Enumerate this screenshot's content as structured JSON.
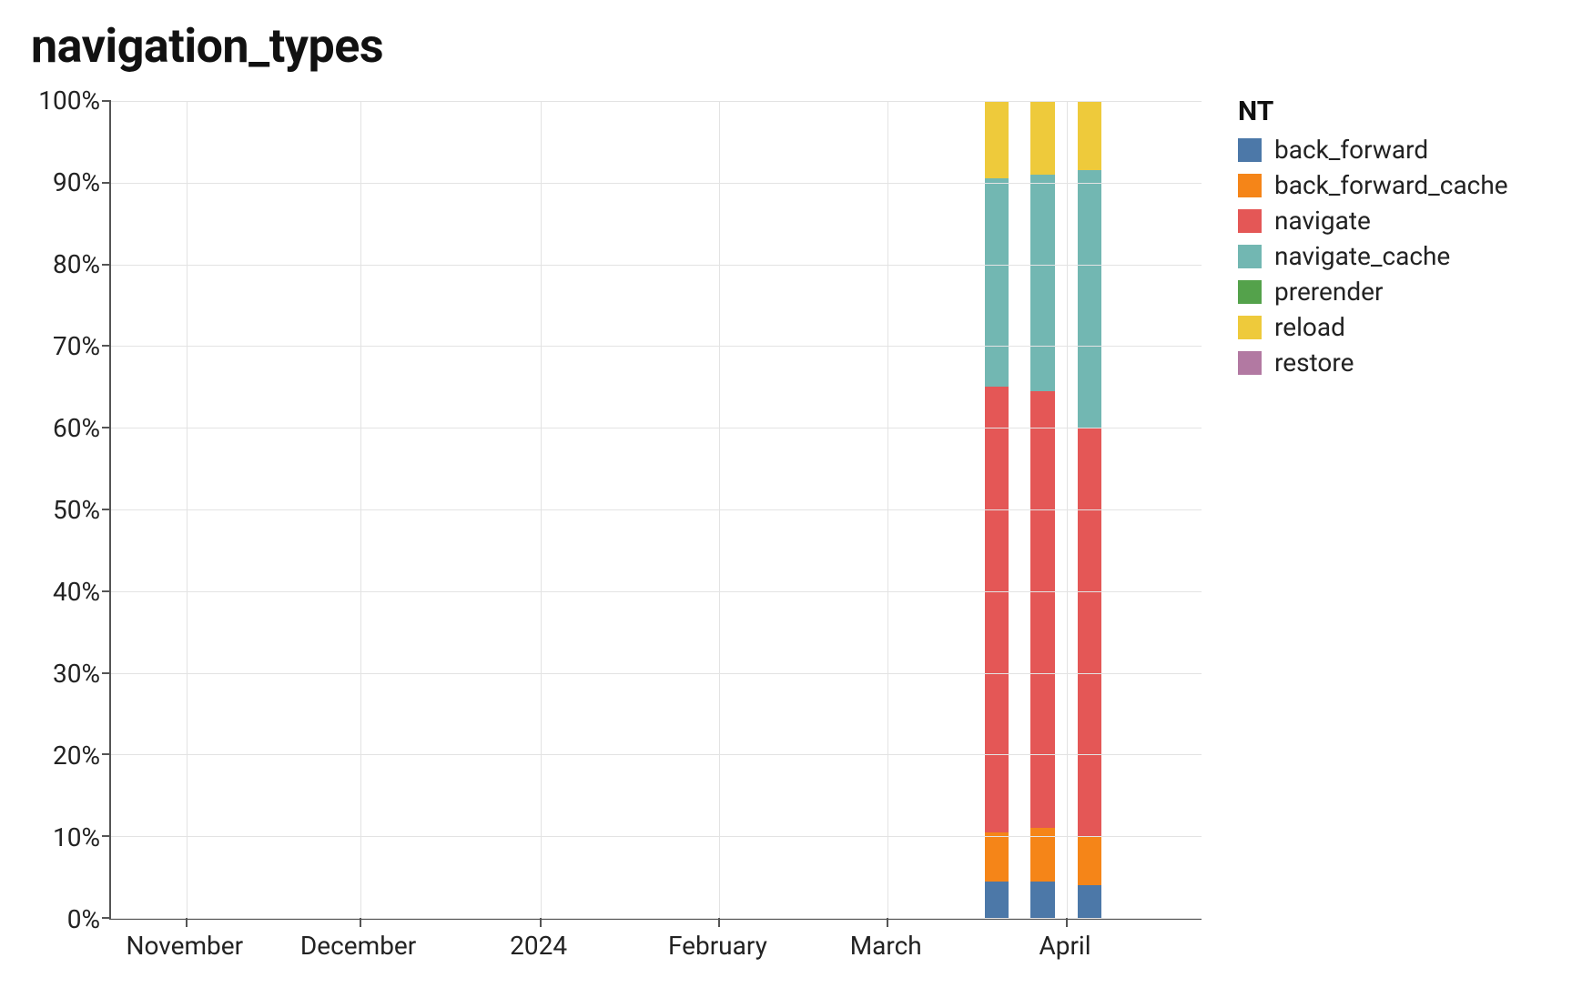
{
  "chart_data": {
    "type": "bar",
    "stacked": true,
    "normalized_to": 100,
    "title": "navigation_types",
    "legend_title": "NT",
    "ylabel": "",
    "xlabel": "",
    "ylim": [
      0,
      100
    ],
    "y_ticks": [
      "100%",
      "90%",
      "80%",
      "70%",
      "60%",
      "50%",
      "40%",
      "30%",
      "20%",
      "10%",
      "0%"
    ],
    "x_ticks": [
      {
        "label": "November",
        "pos_pct": 6.9
      },
      {
        "label": "December",
        "pos_pct": 22.8
      },
      {
        "label": "2024",
        "pos_pct": 39.3
      },
      {
        "label": "February",
        "pos_pct": 55.7
      },
      {
        "label": "March",
        "pos_pct": 71.1
      },
      {
        "label": "April",
        "pos_pct": 87.5
      }
    ],
    "grid_v_pct": [
      6.9,
      22.8,
      39.3,
      55.7,
      71.1,
      87.5
    ],
    "series_order": [
      "back_forward",
      "back_forward_cache",
      "navigate",
      "navigate_cache",
      "prerender",
      "reload",
      "restore"
    ],
    "colors": {
      "back_forward": "#4c78a8",
      "back_forward_cache": "#f58518",
      "navigate": "#e45756",
      "navigate_cache": "#72b7b2",
      "prerender": "#54a24b",
      "reload": "#eeca3b",
      "restore": "#b279a2"
    },
    "bars": [
      {
        "x_pos_pct": 80.0,
        "width_pct": 2.2,
        "values": {
          "back_forward": 4.5,
          "back_forward_cache": 6.0,
          "navigate": 54.5,
          "navigate_cache": 25.5,
          "prerender": 0.0,
          "reload": 9.5,
          "restore": 0.0
        }
      },
      {
        "x_pos_pct": 84.2,
        "width_pct": 2.2,
        "values": {
          "back_forward": 4.5,
          "back_forward_cache": 6.5,
          "navigate": 53.5,
          "navigate_cache": 26.5,
          "prerender": 0.0,
          "reload": 9.0,
          "restore": 0.0
        }
      },
      {
        "x_pos_pct": 88.5,
        "width_pct": 2.2,
        "values": {
          "back_forward": 4.0,
          "back_forward_cache": 6.0,
          "navigate": 50.0,
          "navigate_cache": 31.5,
          "prerender": 0.0,
          "reload": 8.5,
          "restore": 0.0
        }
      }
    ]
  }
}
